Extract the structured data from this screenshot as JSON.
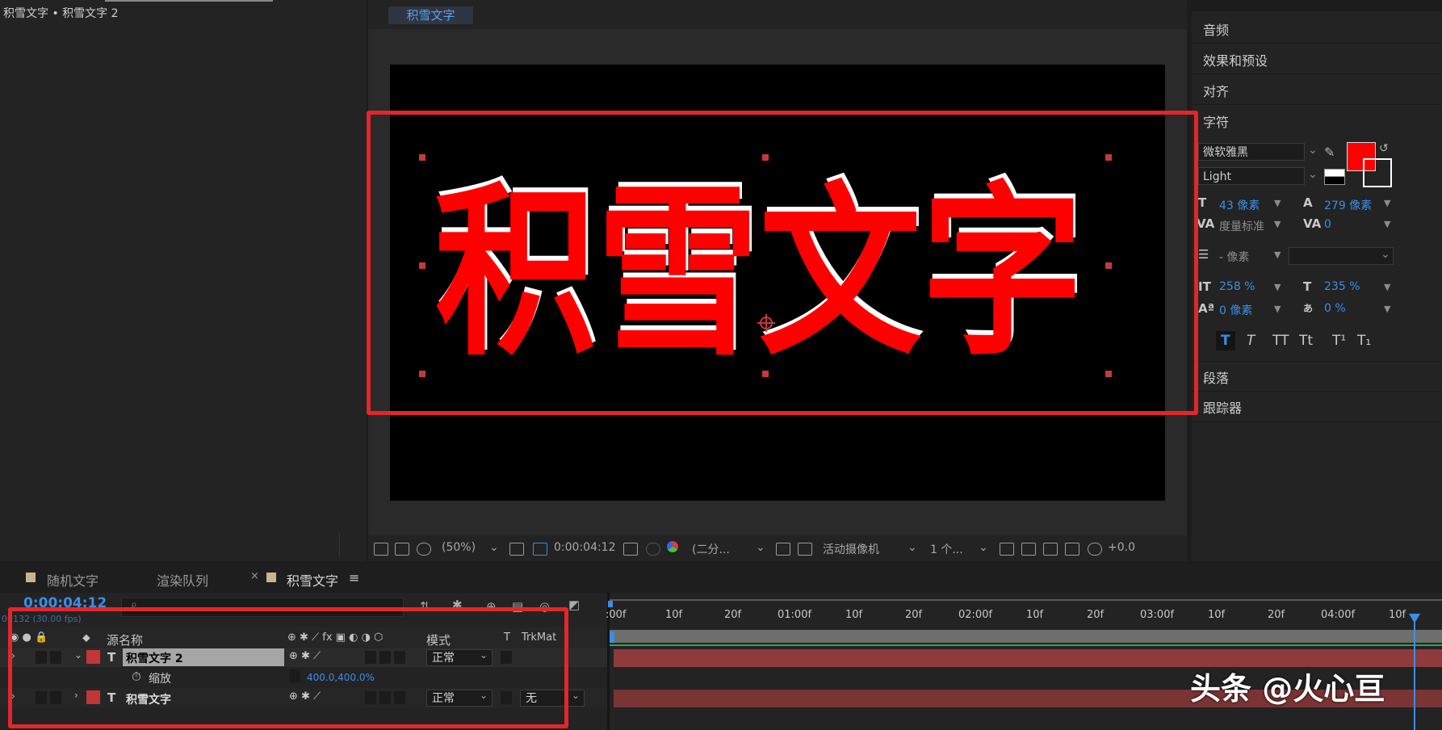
{
  "project": {
    "title": "积雪文字 • 积雪文字 2"
  },
  "viewer": {
    "tab": "积雪文字",
    "canvas_text": "积雪文字",
    "toolbar": {
      "zoom": "(50%)",
      "timecode": "0:00:04:12",
      "resolution": "(二分...",
      "camera": "活动摄像机",
      "views": "1 个...",
      "exposure": "+0.0"
    }
  },
  "right_panel": {
    "audio": "音频",
    "effects": "效果和预设",
    "align": "对齐",
    "character": "字符",
    "paragraph": "段落",
    "tracker": "跟踪器"
  },
  "character": {
    "font": "微软雅黑",
    "style": "Light",
    "font_size": "43 像素",
    "leading": "279 像素",
    "kerning": "度量标准",
    "tracking": "0",
    "stroke": "- 像素",
    "vscale": "258 %",
    "hscale": "235 %",
    "baseline": "0 像素",
    "tsume": "0 %",
    "fill_color": "#ff0000",
    "style_buttons": [
      "T",
      "T",
      "TT",
      "Tt",
      "T¹",
      "T₁"
    ]
  },
  "timeline": {
    "tabs": [
      "随机文字",
      "渲染队列",
      "积雪文字"
    ],
    "timecode": "0:00:04:12",
    "frame_info": "00132 (30.00 fps)",
    "columns": {
      "source": "源名称",
      "mode": "模式",
      "t": "T",
      "trkmat": "TrkMat"
    },
    "ruler": [
      ":00f",
      "10f",
      "20f",
      "01:00f",
      "10f",
      "20f",
      "02:00f",
      "10f",
      "20f",
      "03:00f",
      "10f",
      "20f",
      "04:00f",
      "10f"
    ],
    "layers": [
      {
        "name": "积雪文字 2",
        "mode": "正常",
        "property": "缩放",
        "value": "400.0,400.0%"
      },
      {
        "name": "积雪文字",
        "mode": "正常",
        "trkmat": "无"
      }
    ]
  },
  "watermark": "头条 @火心亘"
}
